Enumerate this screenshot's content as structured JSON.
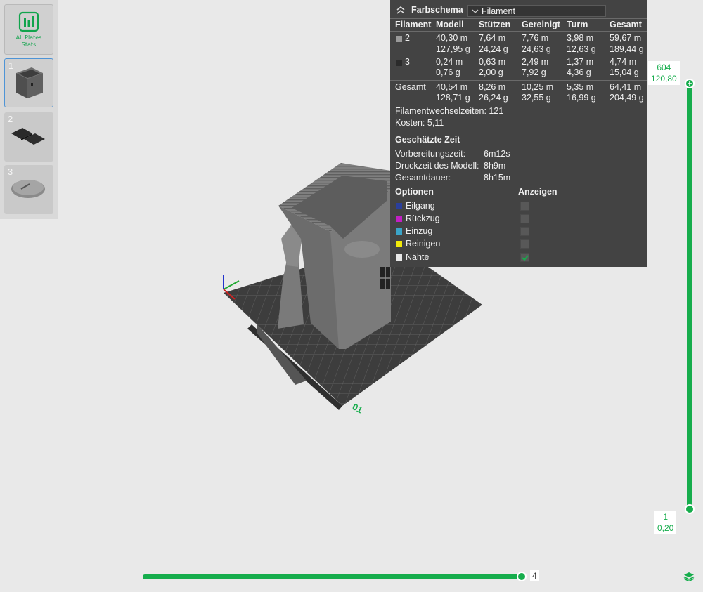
{
  "sidebar": {
    "stats_label_line1": "All Plates",
    "stats_label_line2": "Stats",
    "plates": [
      {
        "number": "1"
      },
      {
        "number": "2"
      },
      {
        "number": "3"
      }
    ]
  },
  "panel": {
    "title": "Farbschema",
    "scheme_value": "Filament",
    "table": {
      "headers": [
        "Filament",
        "Modell",
        "Stützen",
        "Gereinigt",
        "Turm",
        "Gesamt"
      ],
      "rows": [
        {
          "id": "2",
          "color": "#9a9a9a",
          "modell": [
            "40,30 m",
            "127,95 g"
          ],
          "stuetzen": [
            "7,64 m",
            "24,24 g"
          ],
          "gereinigt": [
            "7,76 m",
            "24,63 g"
          ],
          "turm": [
            "3,98 m",
            "12,63 g"
          ],
          "gesamt": [
            "59,67 m",
            "189,44 g"
          ]
        },
        {
          "id": "3",
          "color": "#2b2b2b",
          "modell": [
            "0,24 m",
            "0,76 g"
          ],
          "stuetzen": [
            "0,63 m",
            "2,00 g"
          ],
          "gereinigt": [
            "2,49 m",
            "7,92 g"
          ],
          "turm": [
            "1,37 m",
            "4,36 g"
          ],
          "gesamt": [
            "4,74 m",
            "15,04 g"
          ]
        }
      ],
      "total": {
        "label": "Gesamt",
        "modell": [
          "40,54 m",
          "128,71 g"
        ],
        "stuetzen": [
          "8,26 m",
          "26,24 g"
        ],
        "gereinigt": [
          "10,25 m",
          "32,55 g"
        ],
        "turm": [
          "5,35 m",
          "16,99 g"
        ],
        "gesamt": [
          "64,41 m",
          "204,49 g"
        ]
      }
    },
    "filament_changes": "Filamentwechselzeiten:  121",
    "cost": "Kosten:  5,11",
    "time_header": "Geschätzte Zeit",
    "times": [
      {
        "label": "Vorbereitungszeit:",
        "value": "6m12s"
      },
      {
        "label": "Druckzeit des Modell:",
        "value": "8h9m"
      },
      {
        "label": "Gesamtdauer:",
        "value": "8h15m"
      }
    ],
    "options_header": "Optionen",
    "show_header": "Anzeigen",
    "options": [
      {
        "label": "Eilgang",
        "color": "#2b3f9c",
        "checked": false
      },
      {
        "label": "Rückzug",
        "color": "#c21fc4",
        "checked": false
      },
      {
        "label": "Einzug",
        "color": "#3aa4c8",
        "checked": false
      },
      {
        "label": "Reinigen",
        "color": "#f2ea0a",
        "checked": false
      },
      {
        "label": "Nähte",
        "color": "#e8e8e8",
        "checked": true
      }
    ]
  },
  "vertical_slider": {
    "top_layer": "604",
    "top_height": "120,80",
    "bottom_layer": "1",
    "bottom_height": "0,20"
  },
  "horizontal_slider": {
    "value": "4"
  },
  "plate_label": "01",
  "colors": {
    "accent": "#16ad4c",
    "panel_bg": "#434343"
  }
}
